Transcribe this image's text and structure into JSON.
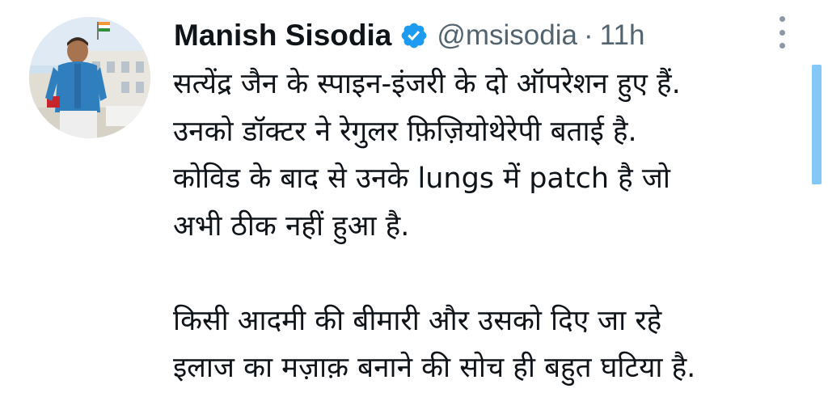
{
  "author": {
    "name": "Manish Sisodia",
    "handle": "@msisodia",
    "separator": "·",
    "time": "11h",
    "verified": true
  },
  "tweet": {
    "paragraphs": [
      [
        "सत्येंद्र जैन के स्पाइन-इंजरी के दो ऑपरेशन हुए हैं.",
        "उनको डॉक्टर ने रेगुलर फ़िज़ियोथेरेपी बताई है.",
        "कोविड के बाद से उनके lungs में patch है जो",
        "अभी ठीक नहीं हुआ है."
      ],
      [
        "किसी आदमी की बीमारी और उसको दिए जा रहे",
        "इलाज का मज़ाक़ बनाने की सोच ही बहुत घटिया है."
      ]
    ]
  },
  "colors": {
    "text": "#0f1419",
    "secondary": "#536471",
    "verified": "#1d9bf0",
    "more_dots": "#8b98a5",
    "scrollbar": "#1d9bf0"
  },
  "icons": {
    "verified": "verified-badge-icon",
    "more": "more-options-icon"
  }
}
